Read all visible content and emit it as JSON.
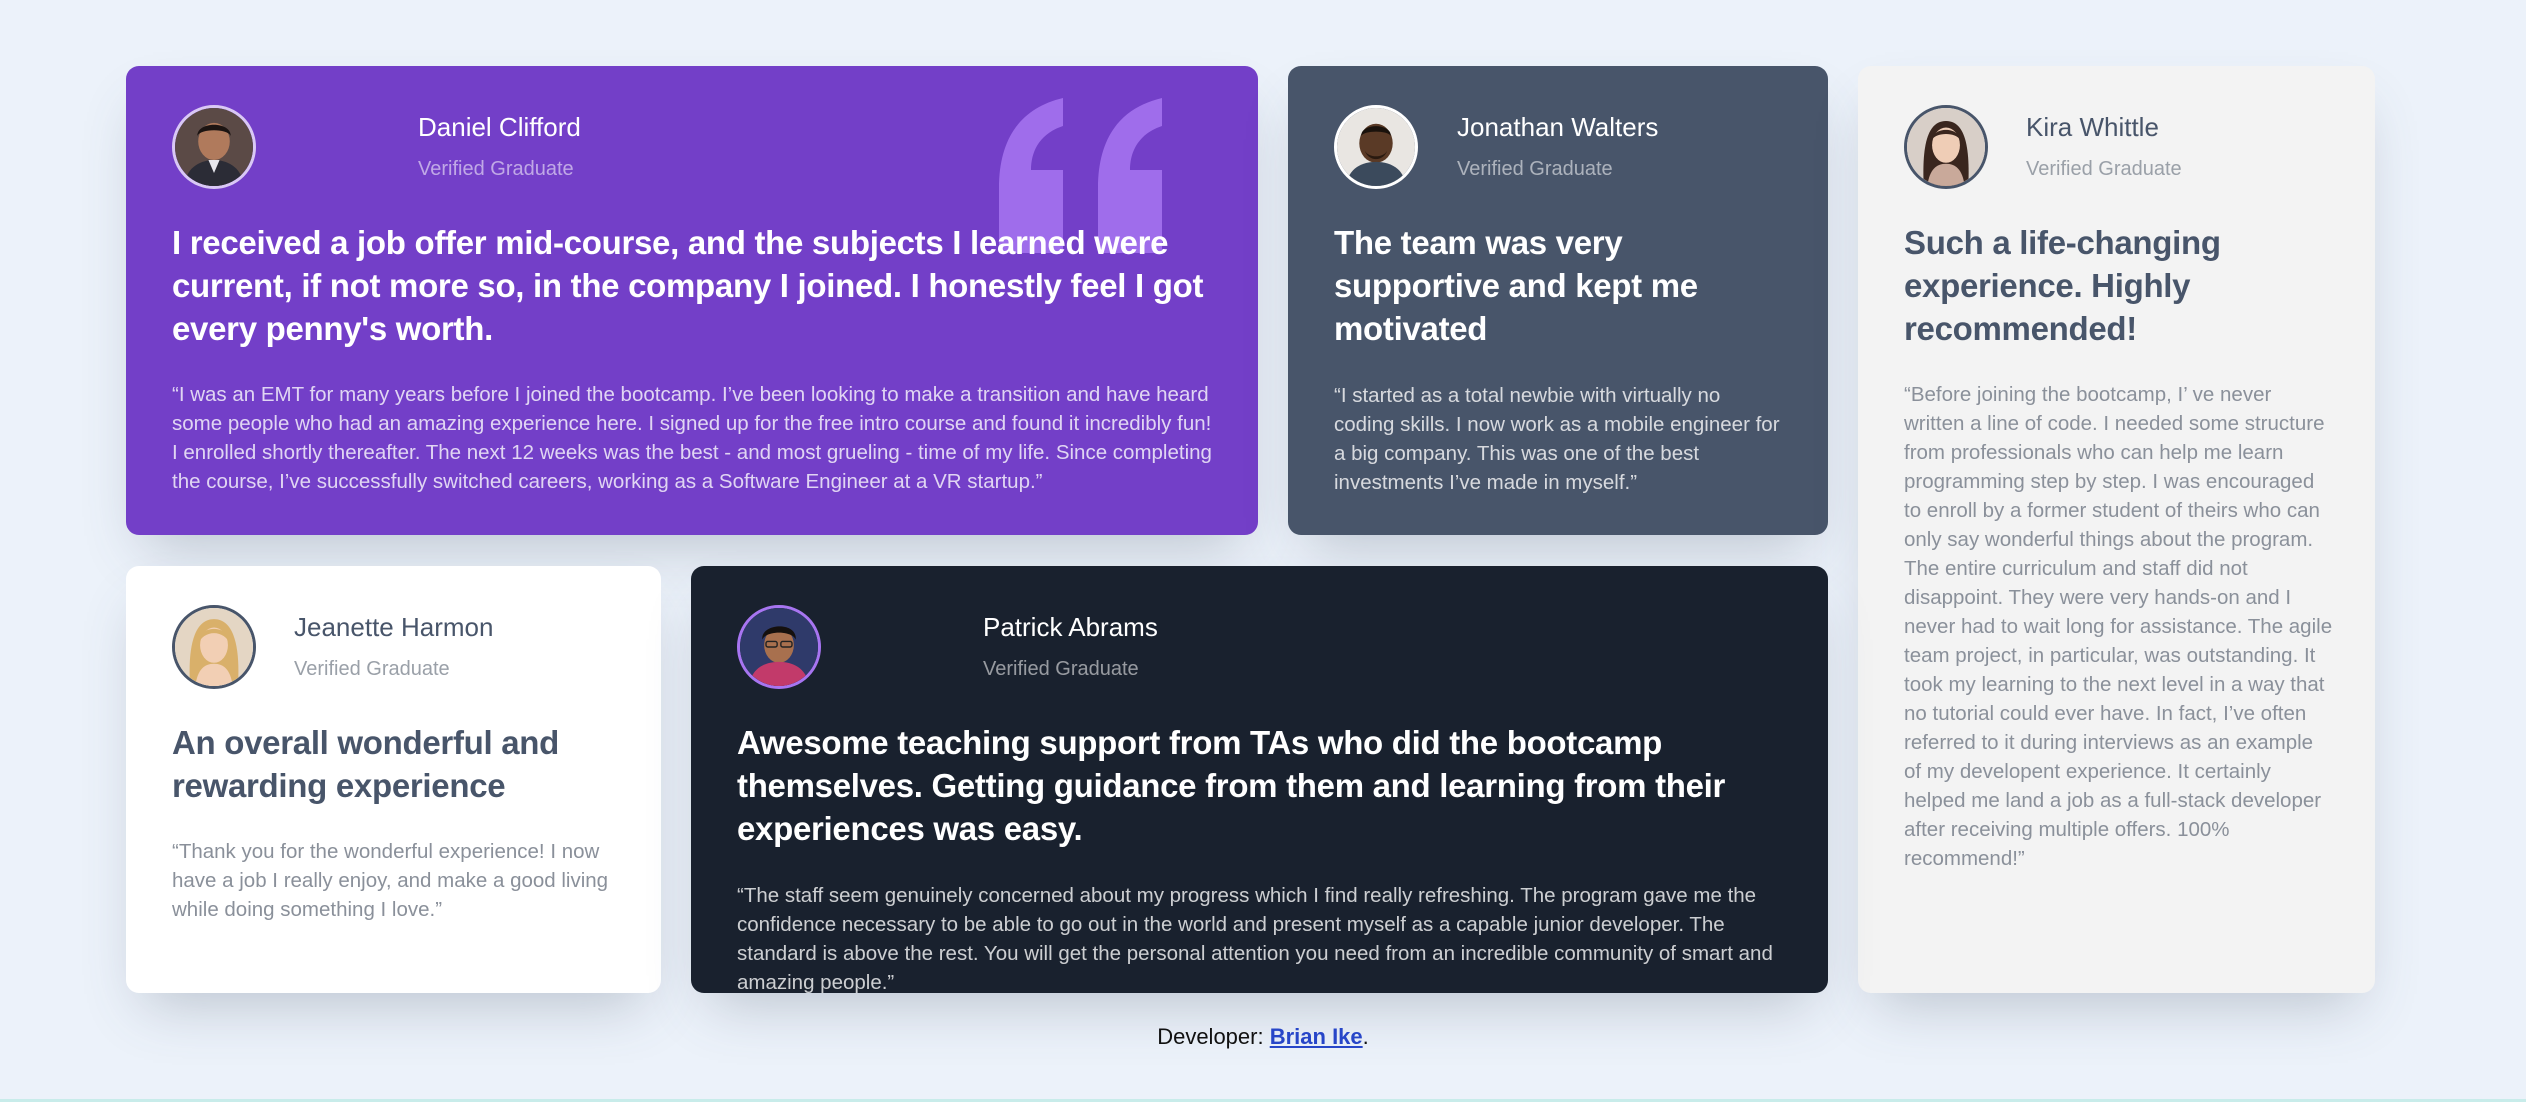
{
  "testimonials": [
    {
      "name": "Daniel Clifford",
      "role": "Verified Graduate",
      "headline": "I received a job offer mid-course, and the subjects I learned were current, if not more so, in the company I joined. I honestly feel I got every penny's worth.",
      "body": "“I was an EMT for many years before I joined the bootcamp. I’ve been looking to make a transition and have heard some people who had an amazing experience here. I signed up for the free intro course and found it incredibly fun! I enrolled shortly thereafter. The next 12 weeks was the best - and most grueling - time of my life. Since completing the course, I’ve successfully switched careers, working as a Software Engineer at a VR startup.”",
      "background": "#733fc8"
    },
    {
      "name": "Jonathan Walters",
      "role": "Verified Graduate",
      "headline": "The team was very supportive and kept me motivated",
      "body": "“I started as a total newbie with virtually no coding skills. I now work as a mobile engineer for a big company. This was one of the best investments I’ve made in myself.”",
      "background": "#48556a"
    },
    {
      "name": "Kira Whittle",
      "role": "Verified Graduate",
      "headline": "Such a life-changing experience. Highly recommended!",
      "body": "“Before joining the bootcamp, I’ ve never written a line of code. I needed some structure from professionals who can help me learn programming step by step. I was encouraged to enroll by a former student of theirs who can only say wonderful things about the program. The entire curriculum and staff did not disappoint. They were very hands-on and I never had to wait long for assistance. The agile team project, in particular, was outstanding. It took my learning to the next level in a way that no tutorial could ever have. In fact, I’ve often referred to it during interviews as an example of my developent experience. It certainly helped me land a job as a full-stack developer after receiving multiple offers. 100% recommend!”",
      "background": "#f3f3f3"
    },
    {
      "name": "Jeanette Harmon",
      "role": "Verified Graduate",
      "headline": "An overall wonderful and rewarding experience",
      "body": "“Thank you for the wonderful experience! I now have a job I really enjoy, and make a good living while doing something I love.”",
      "background": "#ffffff"
    },
    {
      "name": "Patrick Abrams",
      "role": "Verified Graduate",
      "headline": "Awesome teaching support from TAs who did the bootcamp themselves. Getting guidance from them and learning from their experiences was easy.",
      "body": "“The staff seem genuinely concerned about my progress which I find really refreshing. The program gave me the confidence necessary to be able to go out in the world and present myself as a capable junior developer. The standard is above the rest. You will get the personal attention you need from an incredible community of smart and amazing people.”",
      "background": "#19212e"
    }
  ],
  "footer": {
    "prefix": "Developer: ",
    "link_text": "Brian Ike",
    "suffix": "."
  },
  "icons": {
    "quote": "quotation-mark-icon"
  },
  "colors": {
    "page_background": "#ecf2fa",
    "quote_mark": "#a775f1",
    "link": "#2746c8"
  }
}
